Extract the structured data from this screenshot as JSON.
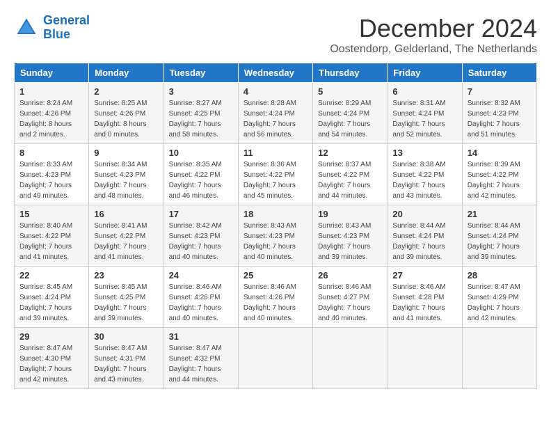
{
  "header": {
    "logo_line1": "General",
    "logo_line2": "Blue",
    "month_title": "December 2024",
    "subtitle": "Oostendorp, Gelderland, The Netherlands"
  },
  "days_of_week": [
    "Sunday",
    "Monday",
    "Tuesday",
    "Wednesday",
    "Thursday",
    "Friday",
    "Saturday"
  ],
  "weeks": [
    [
      {
        "num": "1",
        "sunrise": "Sunrise: 8:24 AM",
        "sunset": "Sunset: 4:26 PM",
        "daylight": "Daylight: 8 hours and 2 minutes."
      },
      {
        "num": "2",
        "sunrise": "Sunrise: 8:25 AM",
        "sunset": "Sunset: 4:26 PM",
        "daylight": "Daylight: 8 hours and 0 minutes."
      },
      {
        "num": "3",
        "sunrise": "Sunrise: 8:27 AM",
        "sunset": "Sunset: 4:25 PM",
        "daylight": "Daylight: 7 hours and 58 minutes."
      },
      {
        "num": "4",
        "sunrise": "Sunrise: 8:28 AM",
        "sunset": "Sunset: 4:24 PM",
        "daylight": "Daylight: 7 hours and 56 minutes."
      },
      {
        "num": "5",
        "sunrise": "Sunrise: 8:29 AM",
        "sunset": "Sunset: 4:24 PM",
        "daylight": "Daylight: 7 hours and 54 minutes."
      },
      {
        "num": "6",
        "sunrise": "Sunrise: 8:31 AM",
        "sunset": "Sunset: 4:24 PM",
        "daylight": "Daylight: 7 hours and 52 minutes."
      },
      {
        "num": "7",
        "sunrise": "Sunrise: 8:32 AM",
        "sunset": "Sunset: 4:23 PM",
        "daylight": "Daylight: 7 hours and 51 minutes."
      }
    ],
    [
      {
        "num": "8",
        "sunrise": "Sunrise: 8:33 AM",
        "sunset": "Sunset: 4:23 PM",
        "daylight": "Daylight: 7 hours and 49 minutes."
      },
      {
        "num": "9",
        "sunrise": "Sunrise: 8:34 AM",
        "sunset": "Sunset: 4:23 PM",
        "daylight": "Daylight: 7 hours and 48 minutes."
      },
      {
        "num": "10",
        "sunrise": "Sunrise: 8:35 AM",
        "sunset": "Sunset: 4:22 PM",
        "daylight": "Daylight: 7 hours and 46 minutes."
      },
      {
        "num": "11",
        "sunrise": "Sunrise: 8:36 AM",
        "sunset": "Sunset: 4:22 PM",
        "daylight": "Daylight: 7 hours and 45 minutes."
      },
      {
        "num": "12",
        "sunrise": "Sunrise: 8:37 AM",
        "sunset": "Sunset: 4:22 PM",
        "daylight": "Daylight: 7 hours and 44 minutes."
      },
      {
        "num": "13",
        "sunrise": "Sunrise: 8:38 AM",
        "sunset": "Sunset: 4:22 PM",
        "daylight": "Daylight: 7 hours and 43 minutes."
      },
      {
        "num": "14",
        "sunrise": "Sunrise: 8:39 AM",
        "sunset": "Sunset: 4:22 PM",
        "daylight": "Daylight: 7 hours and 42 minutes."
      }
    ],
    [
      {
        "num": "15",
        "sunrise": "Sunrise: 8:40 AM",
        "sunset": "Sunset: 4:22 PM",
        "daylight": "Daylight: 7 hours and 41 minutes."
      },
      {
        "num": "16",
        "sunrise": "Sunrise: 8:41 AM",
        "sunset": "Sunset: 4:22 PM",
        "daylight": "Daylight: 7 hours and 41 minutes."
      },
      {
        "num": "17",
        "sunrise": "Sunrise: 8:42 AM",
        "sunset": "Sunset: 4:23 PM",
        "daylight": "Daylight: 7 hours and 40 minutes."
      },
      {
        "num": "18",
        "sunrise": "Sunrise: 8:43 AM",
        "sunset": "Sunset: 4:23 PM",
        "daylight": "Daylight: 7 hours and 40 minutes."
      },
      {
        "num": "19",
        "sunrise": "Sunrise: 8:43 AM",
        "sunset": "Sunset: 4:23 PM",
        "daylight": "Daylight: 7 hours and 39 minutes."
      },
      {
        "num": "20",
        "sunrise": "Sunrise: 8:44 AM",
        "sunset": "Sunset: 4:24 PM",
        "daylight": "Daylight: 7 hours and 39 minutes."
      },
      {
        "num": "21",
        "sunrise": "Sunrise: 8:44 AM",
        "sunset": "Sunset: 4:24 PM",
        "daylight": "Daylight: 7 hours and 39 minutes."
      }
    ],
    [
      {
        "num": "22",
        "sunrise": "Sunrise: 8:45 AM",
        "sunset": "Sunset: 4:24 PM",
        "daylight": "Daylight: 7 hours and 39 minutes."
      },
      {
        "num": "23",
        "sunrise": "Sunrise: 8:45 AM",
        "sunset": "Sunset: 4:25 PM",
        "daylight": "Daylight: 7 hours and 39 minutes."
      },
      {
        "num": "24",
        "sunrise": "Sunrise: 8:46 AM",
        "sunset": "Sunset: 4:26 PM",
        "daylight": "Daylight: 7 hours and 40 minutes."
      },
      {
        "num": "25",
        "sunrise": "Sunrise: 8:46 AM",
        "sunset": "Sunset: 4:26 PM",
        "daylight": "Daylight: 7 hours and 40 minutes."
      },
      {
        "num": "26",
        "sunrise": "Sunrise: 8:46 AM",
        "sunset": "Sunset: 4:27 PM",
        "daylight": "Daylight: 7 hours and 40 minutes."
      },
      {
        "num": "27",
        "sunrise": "Sunrise: 8:46 AM",
        "sunset": "Sunset: 4:28 PM",
        "daylight": "Daylight: 7 hours and 41 minutes."
      },
      {
        "num": "28",
        "sunrise": "Sunrise: 8:47 AM",
        "sunset": "Sunset: 4:29 PM",
        "daylight": "Daylight: 7 hours and 42 minutes."
      }
    ],
    [
      {
        "num": "29",
        "sunrise": "Sunrise: 8:47 AM",
        "sunset": "Sunset: 4:30 PM",
        "daylight": "Daylight: 7 hours and 42 minutes."
      },
      {
        "num": "30",
        "sunrise": "Sunrise: 8:47 AM",
        "sunset": "Sunset: 4:31 PM",
        "daylight": "Daylight: 7 hours and 43 minutes."
      },
      {
        "num": "31",
        "sunrise": "Sunrise: 8:47 AM",
        "sunset": "Sunset: 4:32 PM",
        "daylight": "Daylight: 7 hours and 44 minutes."
      },
      null,
      null,
      null,
      null
    ]
  ]
}
